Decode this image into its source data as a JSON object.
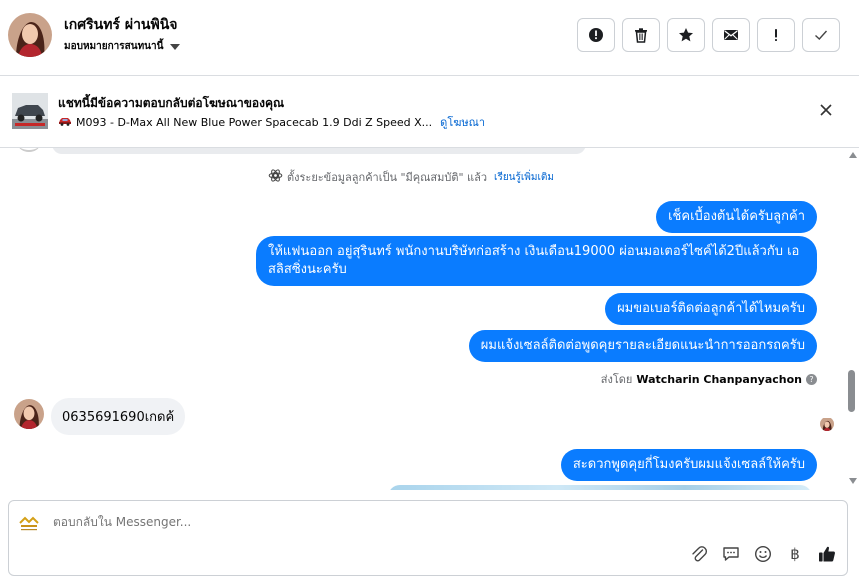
{
  "header": {
    "contact_name": "เกศรินทร์ ผ่านพินิจ",
    "assign_label": "มอบหมายการสนทนานี้",
    "actions": [
      {
        "icon": "alert-circle-icon",
        "name": "mark-spam-button"
      },
      {
        "icon": "trash-icon",
        "name": "delete-button"
      },
      {
        "icon": "star-icon",
        "name": "star-button"
      },
      {
        "icon": "envelope-icon",
        "name": "mark-unread-button"
      },
      {
        "icon": "exclamation-icon",
        "name": "follow-up-button"
      },
      {
        "icon": "checkmark-icon",
        "name": "mark-done-button"
      }
    ]
  },
  "ad_banner": {
    "title": "แชทนี้มีข้อความตอบกลับต่อโฆษณาของคุณ",
    "ad_name": "M093 - D-Max All New Blue Power Spacecab 1.9 Ddi Z Speed X...",
    "link_label": "ดูโฆษณา"
  },
  "conversation": {
    "system_note": "ตั้งระยะข้อมูลลูกค้าเป็น \"มีคุณสมบัติ\" แล้ว",
    "system_note_link": "เรียนรู้เพิ่มเติม",
    "outgoing_messages": [
      "เช็คเบื้องต้นได้ครับลูกค้า",
      "ให้แฟนออก อยู่สุรินทร์ พนักงานบริษัทก่อสร้าง เงินเดือน19000 ผ่อนมอเตอร์ไซค์ได้2ปีแล้วกับ เอสลิสซิ่งนะครับ",
      "ผมขอเบอร์ติดต่อลูกค้าได้ไหมครับ",
      "ผมแจ้งเซลล์ติดต่อพูดคุยรายละเอียดแนะนำการออกรถครับ"
    ],
    "sent_by_label": "ส่งโดย",
    "sent_by_name": "Watcharin Chanpanyachon",
    "help_glyph": "?",
    "incoming_message": "0635691690เกดค้",
    "outgoing_after": "สะดวกพูดคุยกี่โมงครับผมแจ้งเซลล์ให้ครับ"
  },
  "composer": {
    "placeholder": "ตอบกลับใน Messenger...",
    "tools": [
      "paperclip-icon",
      "saved-replies-icon",
      "emoji-icon",
      "baht-icon",
      "thumbs-up-icon"
    ],
    "baht_glyph": "฿"
  },
  "colors": {
    "accent": "#0a7cff",
    "link": "#0064d1",
    "incoming_bubble": "#f0f2f5",
    "border": "#ccd0d5"
  }
}
